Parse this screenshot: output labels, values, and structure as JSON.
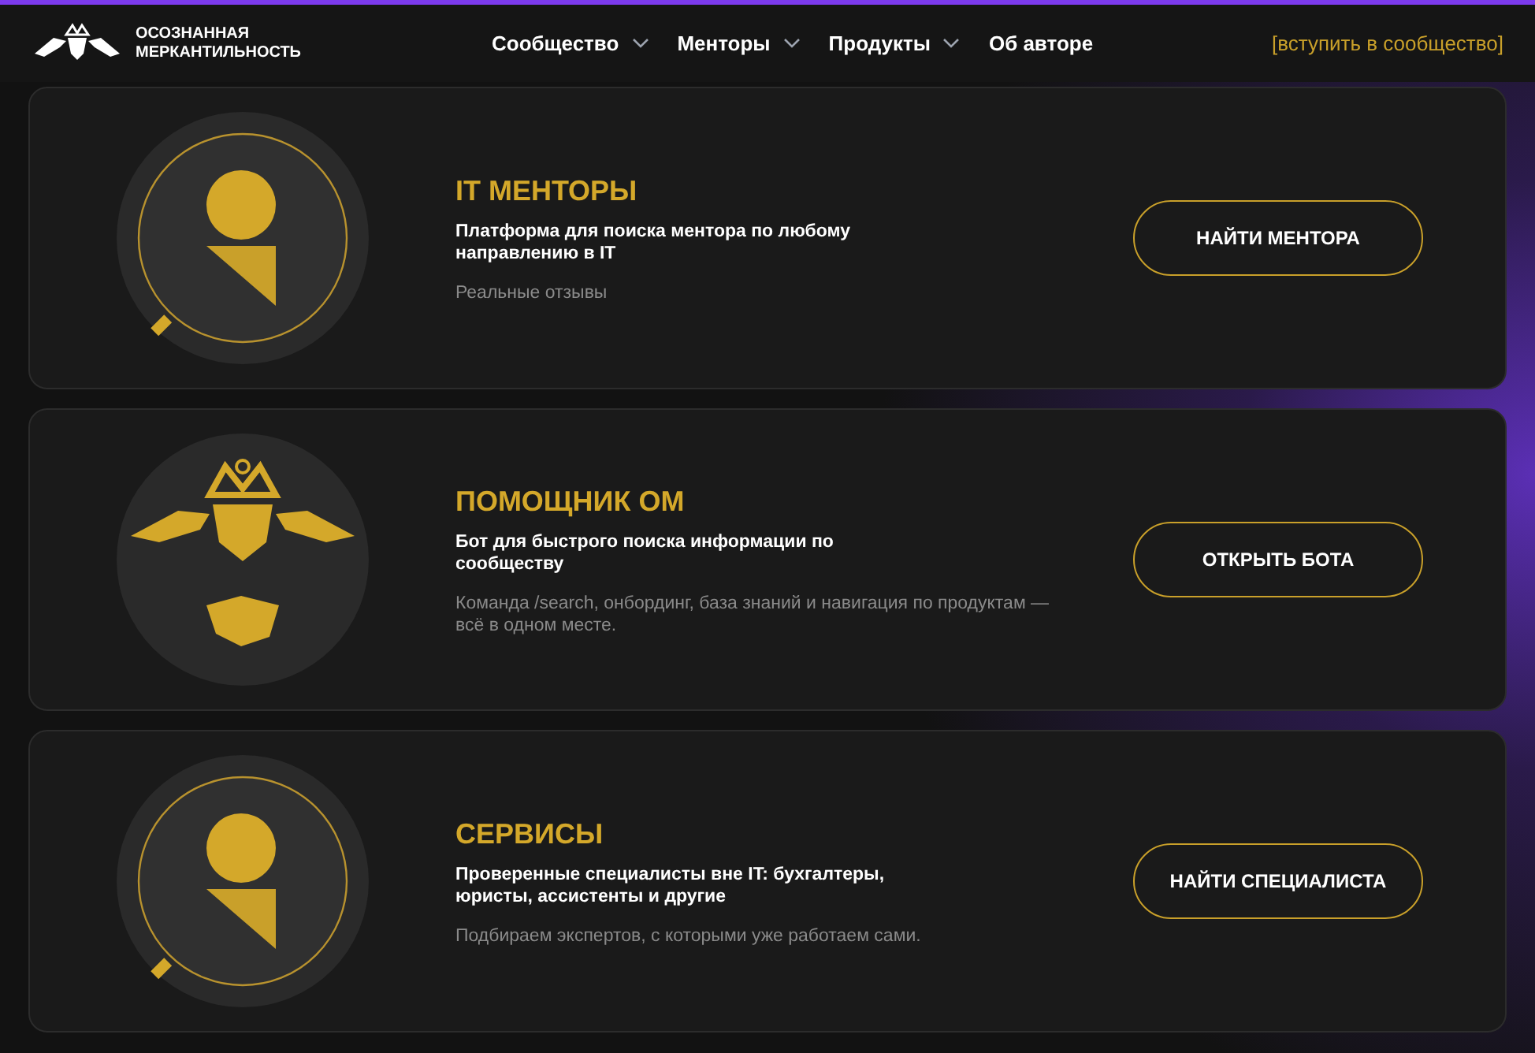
{
  "header": {
    "logo_text": [
      "ОСОЗНАННАЯ",
      "МЕРКАНТИЛЬНОСТЬ"
    ],
    "nav": [
      {
        "label": "Сообщество",
        "dropdown": true
      },
      {
        "label": "Менторы",
        "dropdown": true
      },
      {
        "label": "Продукты",
        "dropdown": true
      },
      {
        "label": "Об авторе",
        "dropdown": false
      }
    ],
    "cta": "[вступить в сообщество]"
  },
  "cards": [
    {
      "kind": "magnifier",
      "title": "IT МЕНТОРЫ",
      "subtitle": "Платформа для поиска ментора по любому направлению в IT",
      "description": "Реальные отзывы",
      "button": "НАЙТИ МЕНТОРА"
    },
    {
      "kind": "emblem",
      "title": "ПОМОЩНИК ОМ",
      "subtitle": "Бот для быстрого поиска информации по сообществу",
      "description": "Команда /search, онбординг, база знаний и навигация по продуктам — всё в одном месте.",
      "button": "ОТКРЫТЬ БОТА"
    },
    {
      "kind": "magnifier",
      "title": "СЕРВИСЫ",
      "subtitle": "Проверенные специалисты вне IT: бухгалтеры, юристы, ассистенты и другие",
      "description": "Подбираем экспертов, с которыми уже работаем сами.",
      "button": "НАЙТИ СПЕЦИАЛИСТА"
    }
  ]
}
